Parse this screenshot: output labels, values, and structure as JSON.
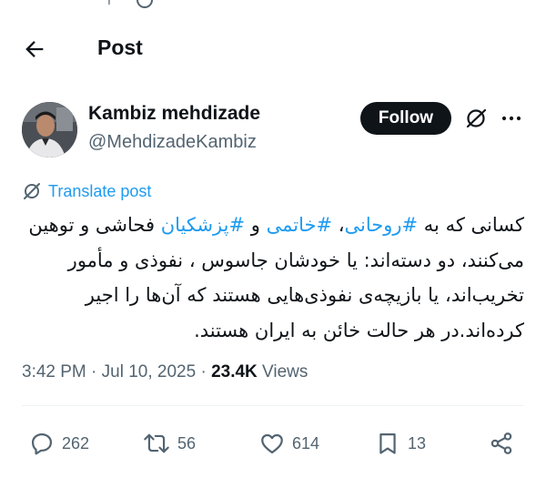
{
  "header": {
    "title": "Post"
  },
  "author": {
    "name": "Kambiz mehdizade",
    "handle": "@MehdizadeKambiz",
    "follow_label": "Follow"
  },
  "translate_label": "Translate post",
  "tweet": {
    "segments": [
      {
        "text": "کسانی که به ",
        "tag": false
      },
      {
        "text": "#روحانی",
        "tag": true
      },
      {
        "text": "، ",
        "tag": false
      },
      {
        "text": "#خاتمی",
        "tag": true
      },
      {
        "text": " و ",
        "tag": false
      },
      {
        "text": "#پزشکیان",
        "tag": true
      },
      {
        "text": " فحاشی و توهین می‌کنند، دو دسته‌اند: یا خودشان جاسوس ، نفوذی و مأمور تخریب‌اند، یا بازیچه‌ی نفوذی‌هایی هستند که آن‌ها را اجیر کرده‌اند.در هر حالت خائن به ایران هستند.",
        "tag": false
      }
    ]
  },
  "meta": {
    "time": "3:42 PM",
    "sep1": " · ",
    "date": "Jul 10, 2025",
    "sep2": " · ",
    "views_count": "23.4K",
    "views_label": " Views"
  },
  "actions": {
    "replies": "262",
    "reposts": "56",
    "likes": "614",
    "bookmarks": "13"
  },
  "colors": {
    "accent": "#1d9bf0",
    "text": "#0f1419",
    "muted": "#536471",
    "follow_bg": "#0f1419"
  },
  "icons": [
    "back-arrow-icon",
    "grok-icon",
    "more-icon",
    "translate-icon",
    "reply-icon",
    "repost-icon",
    "like-icon",
    "bookmark-icon",
    "share-icon"
  ]
}
